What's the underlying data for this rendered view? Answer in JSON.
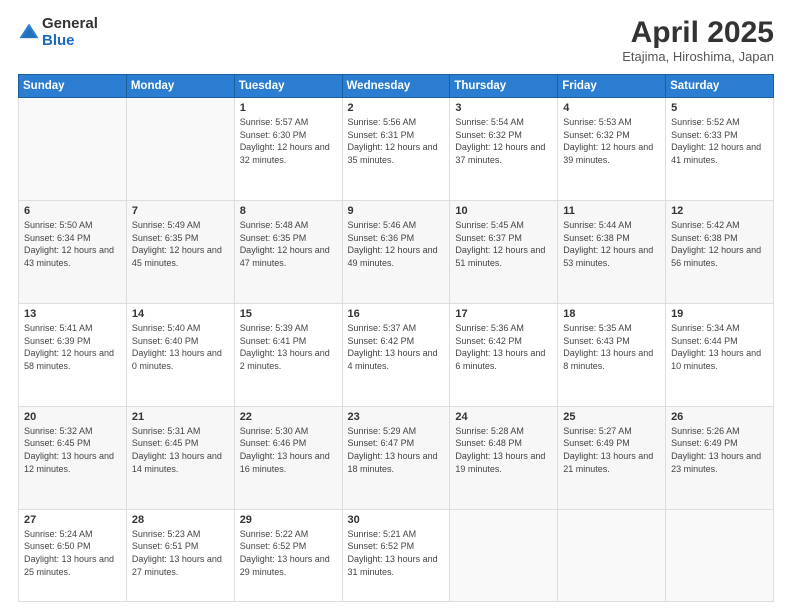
{
  "logo": {
    "general": "General",
    "blue": "Blue"
  },
  "title": "April 2025",
  "subtitle": "Etajima, Hiroshima, Japan",
  "days_of_week": [
    "Sunday",
    "Monday",
    "Tuesday",
    "Wednesday",
    "Thursday",
    "Friday",
    "Saturday"
  ],
  "weeks": [
    [
      {
        "day": "",
        "sunrise": "",
        "sunset": "",
        "daylight": ""
      },
      {
        "day": "",
        "sunrise": "",
        "sunset": "",
        "daylight": ""
      },
      {
        "day": "1",
        "sunrise": "Sunrise: 5:57 AM",
        "sunset": "Sunset: 6:30 PM",
        "daylight": "Daylight: 12 hours and 32 minutes."
      },
      {
        "day": "2",
        "sunrise": "Sunrise: 5:56 AM",
        "sunset": "Sunset: 6:31 PM",
        "daylight": "Daylight: 12 hours and 35 minutes."
      },
      {
        "day": "3",
        "sunrise": "Sunrise: 5:54 AM",
        "sunset": "Sunset: 6:32 PM",
        "daylight": "Daylight: 12 hours and 37 minutes."
      },
      {
        "day": "4",
        "sunrise": "Sunrise: 5:53 AM",
        "sunset": "Sunset: 6:32 PM",
        "daylight": "Daylight: 12 hours and 39 minutes."
      },
      {
        "day": "5",
        "sunrise": "Sunrise: 5:52 AM",
        "sunset": "Sunset: 6:33 PM",
        "daylight": "Daylight: 12 hours and 41 minutes."
      }
    ],
    [
      {
        "day": "6",
        "sunrise": "Sunrise: 5:50 AM",
        "sunset": "Sunset: 6:34 PM",
        "daylight": "Daylight: 12 hours and 43 minutes."
      },
      {
        "day": "7",
        "sunrise": "Sunrise: 5:49 AM",
        "sunset": "Sunset: 6:35 PM",
        "daylight": "Daylight: 12 hours and 45 minutes."
      },
      {
        "day": "8",
        "sunrise": "Sunrise: 5:48 AM",
        "sunset": "Sunset: 6:35 PM",
        "daylight": "Daylight: 12 hours and 47 minutes."
      },
      {
        "day": "9",
        "sunrise": "Sunrise: 5:46 AM",
        "sunset": "Sunset: 6:36 PM",
        "daylight": "Daylight: 12 hours and 49 minutes."
      },
      {
        "day": "10",
        "sunrise": "Sunrise: 5:45 AM",
        "sunset": "Sunset: 6:37 PM",
        "daylight": "Daylight: 12 hours and 51 minutes."
      },
      {
        "day": "11",
        "sunrise": "Sunrise: 5:44 AM",
        "sunset": "Sunset: 6:38 PM",
        "daylight": "Daylight: 12 hours and 53 minutes."
      },
      {
        "day": "12",
        "sunrise": "Sunrise: 5:42 AM",
        "sunset": "Sunset: 6:38 PM",
        "daylight": "Daylight: 12 hours and 56 minutes."
      }
    ],
    [
      {
        "day": "13",
        "sunrise": "Sunrise: 5:41 AM",
        "sunset": "Sunset: 6:39 PM",
        "daylight": "Daylight: 12 hours and 58 minutes."
      },
      {
        "day": "14",
        "sunrise": "Sunrise: 5:40 AM",
        "sunset": "Sunset: 6:40 PM",
        "daylight": "Daylight: 13 hours and 0 minutes."
      },
      {
        "day": "15",
        "sunrise": "Sunrise: 5:39 AM",
        "sunset": "Sunset: 6:41 PM",
        "daylight": "Daylight: 13 hours and 2 minutes."
      },
      {
        "day": "16",
        "sunrise": "Sunrise: 5:37 AM",
        "sunset": "Sunset: 6:42 PM",
        "daylight": "Daylight: 13 hours and 4 minutes."
      },
      {
        "day": "17",
        "sunrise": "Sunrise: 5:36 AM",
        "sunset": "Sunset: 6:42 PM",
        "daylight": "Daylight: 13 hours and 6 minutes."
      },
      {
        "day": "18",
        "sunrise": "Sunrise: 5:35 AM",
        "sunset": "Sunset: 6:43 PM",
        "daylight": "Daylight: 13 hours and 8 minutes."
      },
      {
        "day": "19",
        "sunrise": "Sunrise: 5:34 AM",
        "sunset": "Sunset: 6:44 PM",
        "daylight": "Daylight: 13 hours and 10 minutes."
      }
    ],
    [
      {
        "day": "20",
        "sunrise": "Sunrise: 5:32 AM",
        "sunset": "Sunset: 6:45 PM",
        "daylight": "Daylight: 13 hours and 12 minutes."
      },
      {
        "day": "21",
        "sunrise": "Sunrise: 5:31 AM",
        "sunset": "Sunset: 6:45 PM",
        "daylight": "Daylight: 13 hours and 14 minutes."
      },
      {
        "day": "22",
        "sunrise": "Sunrise: 5:30 AM",
        "sunset": "Sunset: 6:46 PM",
        "daylight": "Daylight: 13 hours and 16 minutes."
      },
      {
        "day": "23",
        "sunrise": "Sunrise: 5:29 AM",
        "sunset": "Sunset: 6:47 PM",
        "daylight": "Daylight: 13 hours and 18 minutes."
      },
      {
        "day": "24",
        "sunrise": "Sunrise: 5:28 AM",
        "sunset": "Sunset: 6:48 PM",
        "daylight": "Daylight: 13 hours and 19 minutes."
      },
      {
        "day": "25",
        "sunrise": "Sunrise: 5:27 AM",
        "sunset": "Sunset: 6:49 PM",
        "daylight": "Daylight: 13 hours and 21 minutes."
      },
      {
        "day": "26",
        "sunrise": "Sunrise: 5:26 AM",
        "sunset": "Sunset: 6:49 PM",
        "daylight": "Daylight: 13 hours and 23 minutes."
      }
    ],
    [
      {
        "day": "27",
        "sunrise": "Sunrise: 5:24 AM",
        "sunset": "Sunset: 6:50 PM",
        "daylight": "Daylight: 13 hours and 25 minutes."
      },
      {
        "day": "28",
        "sunrise": "Sunrise: 5:23 AM",
        "sunset": "Sunset: 6:51 PM",
        "daylight": "Daylight: 13 hours and 27 minutes."
      },
      {
        "day": "29",
        "sunrise": "Sunrise: 5:22 AM",
        "sunset": "Sunset: 6:52 PM",
        "daylight": "Daylight: 13 hours and 29 minutes."
      },
      {
        "day": "30",
        "sunrise": "Sunrise: 5:21 AM",
        "sunset": "Sunset: 6:52 PM",
        "daylight": "Daylight: 13 hours and 31 minutes."
      },
      {
        "day": "",
        "sunrise": "",
        "sunset": "",
        "daylight": ""
      },
      {
        "day": "",
        "sunrise": "",
        "sunset": "",
        "daylight": ""
      },
      {
        "day": "",
        "sunrise": "",
        "sunset": "",
        "daylight": ""
      }
    ]
  ]
}
